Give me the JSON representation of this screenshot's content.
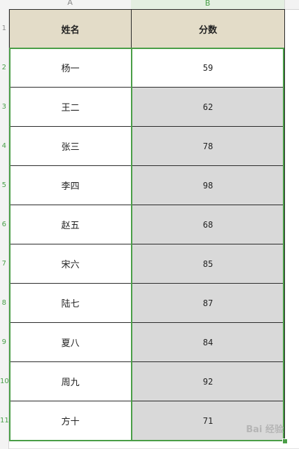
{
  "columns": {
    "a": "A",
    "b": "B"
  },
  "rows": [
    "1",
    "2",
    "3",
    "4",
    "5",
    "6",
    "7",
    "8",
    "9",
    "10",
    "11"
  ],
  "table": {
    "headers": {
      "name": "姓名",
      "score": "分数"
    },
    "records": [
      {
        "name": "杨一",
        "score": "59"
      },
      {
        "name": "王二",
        "score": "62"
      },
      {
        "name": "张三",
        "score": "78"
      },
      {
        "name": "李四",
        "score": "98"
      },
      {
        "name": "赵五",
        "score": "68"
      },
      {
        "name": "宋六",
        "score": "85"
      },
      {
        "name": "陆七",
        "score": "87"
      },
      {
        "name": "夏八",
        "score": "84"
      },
      {
        "name": "周九",
        "score": "92"
      },
      {
        "name": "方十",
        "score": "71"
      }
    ]
  },
  "colors": {
    "header_fill": "#e3dcc8",
    "highlight_fill": "#d9d9d9",
    "selection_border": "#4a9e47"
  },
  "watermark": "Bai 经验"
}
